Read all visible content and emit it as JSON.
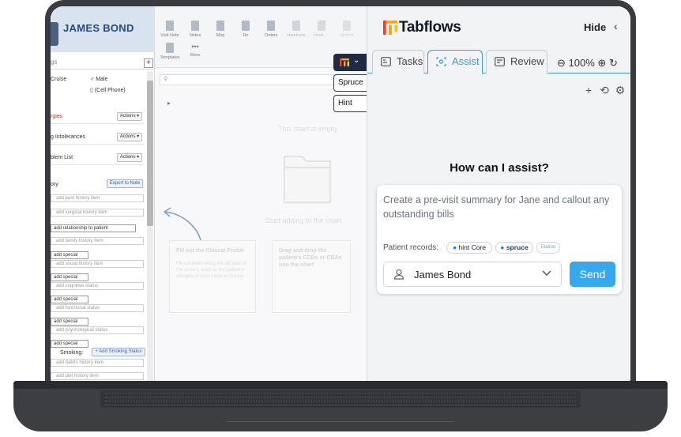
{
  "ehr": {
    "patient_name": "JAMES BOND",
    "side_search_placeholder": "gs",
    "plus_label": "+",
    "demographics": {
      "left_value": "Cruise",
      "gender": "Male",
      "phone": "(Cell Phone)"
    },
    "sections": [
      {
        "label": "rgies",
        "action": "Actions ▾"
      },
      {
        "label": "g Intolerances",
        "action": "Actions ▾"
      },
      {
        "label": "blem List",
        "action": "Actions ▾"
      }
    ],
    "history_label": "ory",
    "export_label": "Export to Note",
    "inputs": {
      "past_history": "add past history item",
      "surgical_history": "add surgical history item",
      "relationship": "add relationship to patient",
      "family_history": "add family history item",
      "special": "add special",
      "social_history": "add social history item",
      "cognitive": "add cognitive status",
      "functional": "add functional status",
      "psychological": "add psychological status",
      "smoking_label": "Smoking:",
      "add_smoking": "+ Add Smoking Status",
      "habits": "add habits history item",
      "diet": "add diet history item"
    },
    "toolbar": [
      {
        "label": "Visit Note"
      },
      {
        "label": "Notes"
      },
      {
        "label": "Msg"
      },
      {
        "label": "Rx"
      },
      {
        "label": "Orders"
      },
      {
        "label": "Handouts"
      },
      {
        "label": "Hook …"
      },
      {
        "label": "Sketch"
      }
    ],
    "toolbar_row2": [
      {
        "label": "Templates"
      },
      {
        "label": "More"
      }
    ],
    "empty_title": "This chart is empty",
    "empty_cta": "Start adding to the chart",
    "card1": {
      "title": "Fill out the Clinical Profile",
      "body": "Fill out fields along the left side of the screen, such as the patient's allergies or past medical history."
    },
    "card2": {
      "title": "Drag and drop the patient's CCDs or CDAs into the chart",
      "body": ""
    }
  },
  "side_tabs": {
    "spruce": "Spruce",
    "hint": "Hint",
    "chevron": "⌄"
  },
  "tabflows": {
    "brand": "Tabflows",
    "hide_label": "Hide",
    "hide_icon": "chevron-left-icon",
    "tabs": [
      {
        "label": "Tasks",
        "active": false
      },
      {
        "label": "Assist",
        "active": true
      },
      {
        "label": "Review",
        "active": false
      }
    ],
    "zoom": "100%",
    "heading": "How can I assist?",
    "prompt": "Create a pre-visit summary for Jane and callout any outstanding bills",
    "records_label": "Patient records:",
    "record_pills": [
      "hint Core",
      "spruce",
      "Elation"
    ],
    "patient_select": "James Bond",
    "send_label": "Send",
    "accent_color": "#38a8ee"
  }
}
